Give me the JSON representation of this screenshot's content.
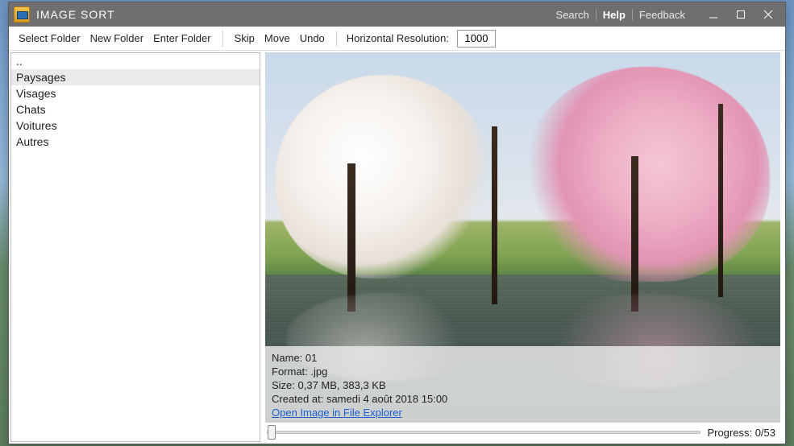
{
  "titlebar": {
    "title": "IMAGE SORT",
    "links": [
      {
        "label": "Search",
        "active": false
      },
      {
        "label": "Help",
        "active": true
      },
      {
        "label": "Feedback",
        "active": false
      }
    ]
  },
  "toolbar": {
    "select_folder": "Select Folder",
    "new_folder": "New Folder",
    "enter_folder": "Enter Folder",
    "skip": "Skip",
    "move": "Move",
    "undo": "Undo",
    "hres_label": "Horizontal Resolution:",
    "hres_value": "1000"
  },
  "sidebar": {
    "items": [
      {
        "label": "..",
        "selected": false
      },
      {
        "label": "Paysages",
        "selected": true
      },
      {
        "label": "Visages",
        "selected": false
      },
      {
        "label": "Chats",
        "selected": false
      },
      {
        "label": "Voitures",
        "selected": false
      },
      {
        "label": "Autres",
        "selected": false
      }
    ]
  },
  "info": {
    "name_label": "Name: ",
    "name_value": "01",
    "format_label": "Format: ",
    "format_value": ".jpg",
    "size_label": "Size: ",
    "size_value": "0,37 MB, 383,3 KB",
    "created_label": "Created at: ",
    "created_value": "samedi 4 août 2018 15:00",
    "open_link": "Open Image in File Explorer"
  },
  "progress": {
    "label_prefix": "Progress: ",
    "value": "0/53"
  }
}
